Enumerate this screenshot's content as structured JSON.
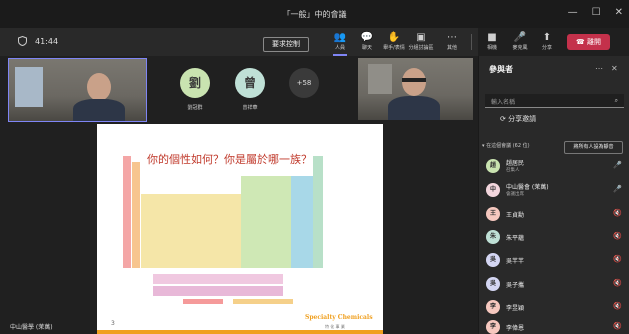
{
  "window": {
    "title": "「一般」中的會議",
    "controls": [
      "—",
      "☐",
      "✕"
    ]
  },
  "toolbar": {
    "timer": "41:44",
    "take_control": "要求控制",
    "items": [
      {
        "label": "人員",
        "icon": "people-icon"
      },
      {
        "label": "聊天",
        "icon": "chat-icon"
      },
      {
        "label": "舉手/表情",
        "icon": "reactions-icon"
      },
      {
        "label": "分組討論區",
        "icon": "breakout-icon"
      },
      {
        "label": "其他",
        "icon": "more-icon"
      },
      {
        "label": "相機",
        "icon": "camera-icon"
      },
      {
        "label": "麥克風",
        "icon": "mic-icon"
      },
      {
        "label": "分享",
        "icon": "share-icon"
      }
    ],
    "leave": "離開"
  },
  "stage": {
    "avatars": [
      {
        "initial": "劉",
        "name": "劉冠群",
        "color": "#c9e3b0"
      },
      {
        "initial": "曾",
        "name": "曾祥華",
        "color": "#bfe0d6"
      }
    ],
    "more_count": "+58",
    "presenter_label": "中山醫學 (茉萬)",
    "slide": {
      "title": "你的個性如何？你是屬於哪一族？",
      "page": "3",
      "brand": "Specialty Chemicals",
      "brand_sub": "特 化 事 業"
    }
  },
  "panel": {
    "title": "參與者",
    "search_placeholder": "輸入名稱",
    "share_invite": "分享邀請",
    "section_label": "在這個會議 (62 位)",
    "mute_all": "將所有人設為靜音",
    "participants": [
      {
        "initial": "趙",
        "name": "趙居民",
        "sub": "召集人",
        "color": "#c9e3b0",
        "mic": "🎤"
      },
      {
        "initial": "中",
        "name": "中山醫會 (茉萬)",
        "sub": "會議出席",
        "color": "#f3d6dd",
        "mic": "🎤"
      },
      {
        "initial": "王",
        "name": "王貞勳",
        "sub": "",
        "color": "#f6c8bf",
        "mic": "🔇"
      },
      {
        "initial": "朱",
        "name": "朱平蘊",
        "sub": "",
        "color": "#bfe0d6",
        "mic": "🔇"
      },
      {
        "initial": "吳",
        "name": "吳芊芊",
        "sub": "",
        "color": "#d4d6f3",
        "mic": "🔇"
      },
      {
        "initial": "吳",
        "name": "吳子攜",
        "sub": "",
        "color": "#d4d6f3",
        "mic": "🔇"
      },
      {
        "initial": "李",
        "name": "李昱穎",
        "sub": "",
        "color": "#f6c8bf",
        "mic": "🔇"
      },
      {
        "initial": "李",
        "name": "李偉恩",
        "sub": "",
        "color": "#f6c8bf",
        "mic": "🔇"
      }
    ]
  }
}
